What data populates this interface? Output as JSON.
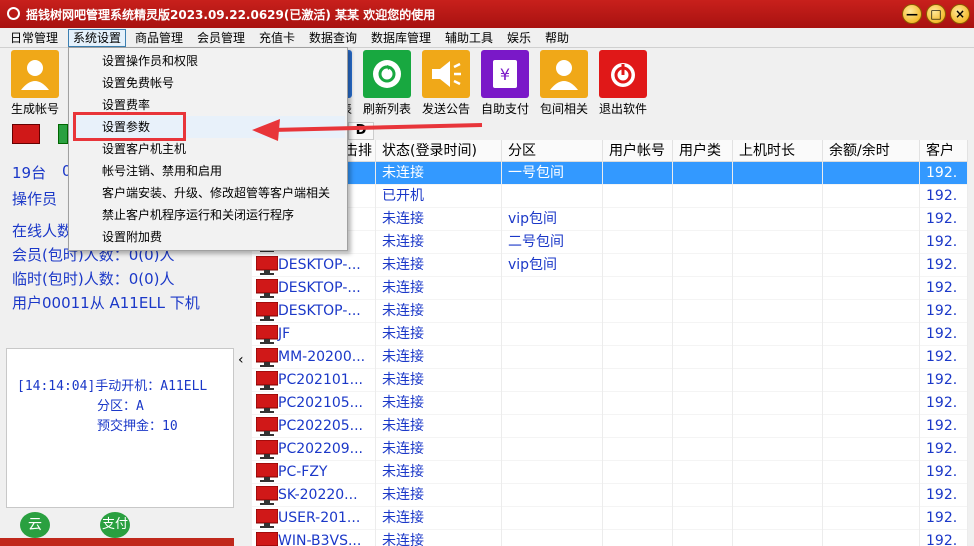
{
  "window": {
    "title": "摇钱树网吧管理系统精灵版2023.09.22.0629(已激活)  某某 欢迎您的使用",
    "min_label": "—",
    "max_label": "□",
    "close_label": "×"
  },
  "menu": [
    "日常管理",
    "系统设置",
    "商品管理",
    "会员管理",
    "充值卡",
    "数据查询",
    "数据库管理",
    "辅助工具",
    "娱乐",
    "帮助"
  ],
  "toolbar": {
    "tools": [
      {
        "label": "生成帐号",
        "icon": "user-icon",
        "color": "#f0a818"
      },
      {
        "label": "刷新列表",
        "icon": "refresh-icon",
        "color": "#18a840"
      },
      {
        "label": "发送公告",
        "icon": "megaphone-icon",
        "color": "#f0a818"
      },
      {
        "label": "自助支付",
        "icon": "yen-icon",
        "color": "#7a18c8"
      },
      {
        "label": "包间相关",
        "icon": "user-icon",
        "color": "#f0a818"
      },
      {
        "label": "退出软件",
        "icon": "power-icon",
        "color": "#e01818"
      }
    ],
    "partial_label_tail": "表"
  },
  "dropdown": {
    "items": [
      "设置操作员和权限",
      "设置免费帐号",
      "设置费率",
      "设置参数",
      "设置客户机主机",
      "帐号注销、禁用和启用",
      "客户端安装、升级、修改超管等客户端相关",
      "禁止客户机程序运行和关闭运行程序",
      "设置附加费"
    ],
    "highlighted_index": 3
  },
  "left": {
    "count_text": "19台",
    "partial_count": "0",
    "operator_label": "操作员",
    "online_text": "在线人数",
    "member_text": "会员(包时)人数：0(0)人",
    "temp_text": "临时(包时)人数：0(0)人",
    "user_text": "用户00011从 A11ELL 下机",
    "log": [
      "[14:14:04]手动开机：A11ELL",
      "分区：A",
      "预交押金：10"
    ],
    "bottom_icons": [
      "云",
      "支付"
    ]
  },
  "grid": {
    "columns": [
      "击排",
      "状态(登录时间)",
      "分区",
      "用户帐号",
      "用户类",
      "上机时长",
      "余额/余时",
      "客户"
    ],
    "rows": [
      {
        "name": "",
        "status": "未连接",
        "zone": "一号包间",
        "ip": "192."
      },
      {
        "name": "",
        "status": "已开机",
        "zone": "",
        "ip": "192."
      },
      {
        "name": "",
        "status": "未连接",
        "zone": "vip包间",
        "ip": "192."
      },
      {
        "name": "",
        "status": "未连接",
        "zone": "二号包间",
        "ip": "192."
      },
      {
        "name": "DESKTOP-...",
        "status": "未连接",
        "zone": "vip包间",
        "ip": "192."
      },
      {
        "name": "DESKTOP-...",
        "status": "未连接",
        "zone": "",
        "ip": "192."
      },
      {
        "name": "DESKTOP-...",
        "status": "未连接",
        "zone": "",
        "ip": "192."
      },
      {
        "name": "JF",
        "status": "未连接",
        "zone": "",
        "ip": "192."
      },
      {
        "name": "MM-20200...",
        "status": "未连接",
        "zone": "",
        "ip": "192."
      },
      {
        "name": "PC202101...",
        "status": "未连接",
        "zone": "",
        "ip": "192."
      },
      {
        "name": "PC202105...",
        "status": "未连接",
        "zone": "",
        "ip": "192."
      },
      {
        "name": "PC202205...",
        "status": "未连接",
        "zone": "",
        "ip": "192."
      },
      {
        "name": "PC202209...",
        "status": "未连接",
        "zone": "",
        "ip": "192."
      },
      {
        "name": "PC-FZY",
        "status": "未连接",
        "zone": "",
        "ip": "192."
      },
      {
        "name": "SK-20220...",
        "status": "未连接",
        "zone": "",
        "ip": "192."
      },
      {
        "name": "USER-201...",
        "status": "未连接",
        "zone": "",
        "ip": "192."
      },
      {
        "name": "WIN-B3VS...",
        "status": "未连接",
        "zone": "",
        "ip": "192."
      }
    ],
    "selected_index": 0
  },
  "colors": {
    "title_red": "#b81a16",
    "link_blue": "#1b38c8",
    "selection": "#3399ff",
    "highlight_red": "#e8353a"
  }
}
